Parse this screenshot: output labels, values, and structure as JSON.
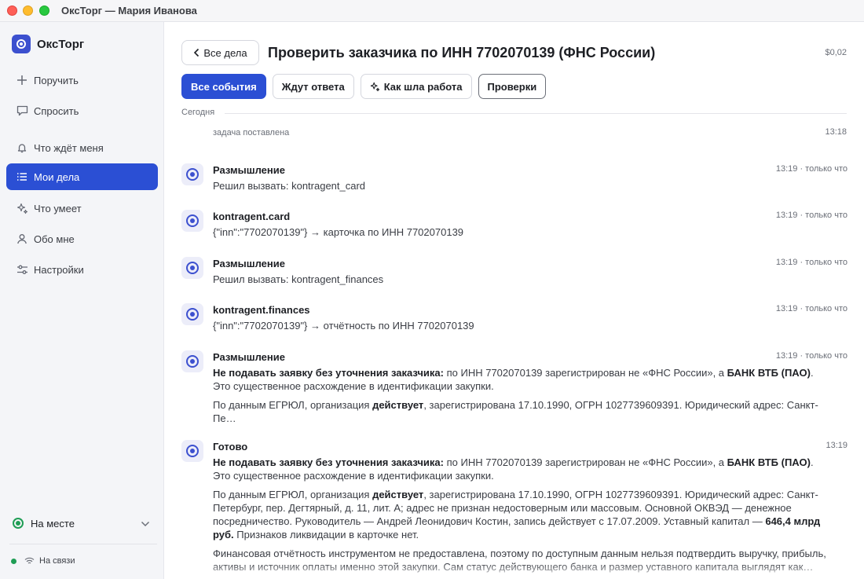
{
  "window": {
    "title": "ОксТорг — Мария Иванова"
  },
  "brand": {
    "name": "ОксТорг"
  },
  "sidebar": {
    "items": [
      {
        "label": "Поручить",
        "icon": "plus-icon"
      },
      {
        "label": "Спросить",
        "icon": "chat-icon"
      },
      {
        "label": "Что ждёт меня",
        "icon": "bell-icon"
      },
      {
        "label": "Мои дела",
        "icon": "list-icon",
        "active": true
      },
      {
        "label": "Что умеет",
        "icon": "sparkle-icon"
      },
      {
        "label": "Обо мне",
        "icon": "person-icon"
      },
      {
        "label": "Настройки",
        "icon": "sliders-icon"
      }
    ],
    "status": "На месте",
    "connection": "На связи"
  },
  "header": {
    "back_label": "Все дела",
    "title": "Проверить заказчика по ИНН 7702070139 (ФНС России)",
    "cost": "$0,02"
  },
  "tabs": [
    {
      "label": "Все события",
      "active": true
    },
    {
      "label": "Ждут ответа"
    },
    {
      "label": "Как шла работа",
      "icon": "sparkle-icon"
    },
    {
      "label": "Проверки"
    }
  ],
  "feed": {
    "day_label": "Сегодня",
    "system_event": {
      "text": "задача поставлена",
      "time": "13:18"
    },
    "events": [
      {
        "title": "Размышление",
        "time": "13:19 · только что",
        "text": "Решил вызвать: kontragent_card"
      },
      {
        "title": "kontragent.card",
        "time": "13:19 · только что",
        "text": "{\"inn\":\"7702070139\"} → карточка по ИНН 7702070139"
      },
      {
        "title": "Размышление",
        "time": "13:19 · только что",
        "text": "Решил вызвать: kontragent_finances"
      },
      {
        "title": "kontragent.finances",
        "time": "13:19 · только что",
        "text": "{\"inn\":\"7702070139\"} → отчётность по ИНН 7702070139"
      },
      {
        "title": "Размышление",
        "time": "13:19 · только что",
        "p1_bold": "Не подавать заявку без уточнения заказчика:",
        "p1_a": " по ИНН 7702070139 зарегистрирован не «ФНС России», а ",
        "p1_bold2": "БАНК ВТБ (ПАО)",
        "p1_b": ". Это существенное расхождение в идентификации закупки.",
        "p2_a": "По данным ЕГРЮЛ, организация ",
        "p2_bold": "действует",
        "p2_b": ", зарегистрирована 17.10.1990, ОГРН 1027739609391. Юридический адрес: Санкт-Пе…"
      },
      {
        "title": "Готово",
        "time": "13:19",
        "p1_bold": "Не подавать заявку без уточнения заказчика:",
        "p1_a": " по ИНН 7702070139 зарегистрирован не «ФНС России», а ",
        "p1_bold2": "БАНК ВТБ (ПАО)",
        "p1_b": ". Это существенное расхождение в идентификации закупки.",
        "p2_a": "По данным ЕГРЮЛ, организация ",
        "p2_bold": "действует",
        "p2_b": ", зарегистрирована 17.10.1990, ОГРН 1027739609391. Юридический адрес: Санкт-Петербург, пер. Дегтярный, д. 11, лит. А; адрес не признан недостоверным или массовым. Основной ОКВЭД — денежное посредничество. Руководитель — Андрей Леонидович Костин, запись действует с 17.07.2009. Уставный капитал — ",
        "p2_bold2": "646,4 млрд руб.",
        "p2_c": " Признаков ликвидации в карточке нет.",
        "p3": "Финансовая отчётность инструментом не предоставлена, поэтому по доступным данным нельзя подтвердить выручку, прибыль, активы и источник оплаты именно этой закупки. Сам статус действующего банка и размер уставного капитала выглядят как…"
      }
    ]
  },
  "colors": {
    "accent": "#2b4fd4",
    "brand": "#3c50cf",
    "online": "#1f9d55"
  }
}
